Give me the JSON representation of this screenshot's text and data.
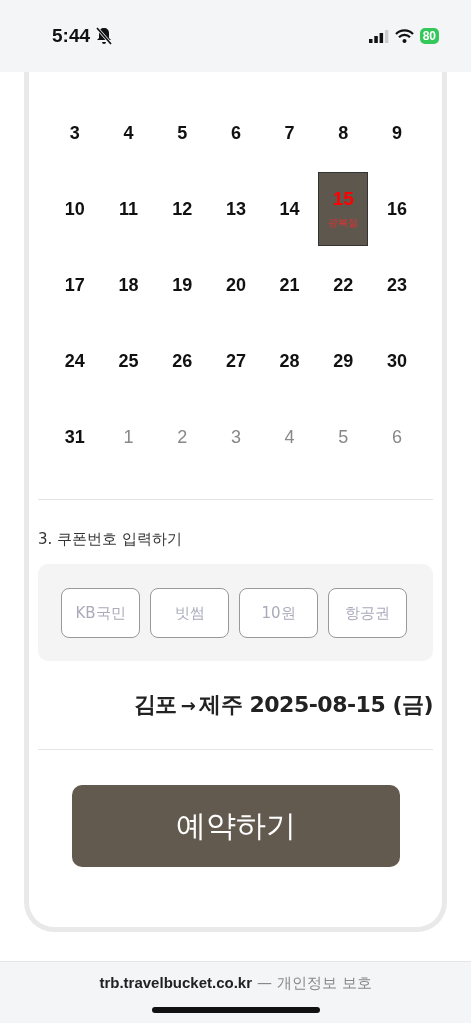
{
  "status_bar": {
    "time": "5:44",
    "battery": "80"
  },
  "calendar": {
    "days": [
      {
        "day": "3",
        "other_month": false,
        "selected": false
      },
      {
        "day": "4",
        "other_month": false,
        "selected": false
      },
      {
        "day": "5",
        "other_month": false,
        "selected": false
      },
      {
        "day": "6",
        "other_month": false,
        "selected": false
      },
      {
        "day": "7",
        "other_month": false,
        "selected": false
      },
      {
        "day": "8",
        "other_month": false,
        "selected": false
      },
      {
        "day": "9",
        "other_month": false,
        "selected": false
      },
      {
        "day": "10",
        "other_month": false,
        "selected": false
      },
      {
        "day": "11",
        "other_month": false,
        "selected": false
      },
      {
        "day": "12",
        "other_month": false,
        "selected": false
      },
      {
        "day": "13",
        "other_month": false,
        "selected": false
      },
      {
        "day": "14",
        "other_month": false,
        "selected": false
      },
      {
        "day": "15",
        "other_month": false,
        "selected": true,
        "holiday": "광복절"
      },
      {
        "day": "16",
        "other_month": false,
        "selected": false
      },
      {
        "day": "17",
        "other_month": false,
        "selected": false
      },
      {
        "day": "18",
        "other_month": false,
        "selected": false
      },
      {
        "day": "19",
        "other_month": false,
        "selected": false
      },
      {
        "day": "20",
        "other_month": false,
        "selected": false
      },
      {
        "day": "21",
        "other_month": false,
        "selected": false
      },
      {
        "day": "22",
        "other_month": false,
        "selected": false
      },
      {
        "day": "23",
        "other_month": false,
        "selected": false
      },
      {
        "day": "24",
        "other_month": false,
        "selected": false
      },
      {
        "day": "25",
        "other_month": false,
        "selected": false
      },
      {
        "day": "26",
        "other_month": false,
        "selected": false
      },
      {
        "day": "27",
        "other_month": false,
        "selected": false
      },
      {
        "day": "28",
        "other_month": false,
        "selected": false
      },
      {
        "day": "29",
        "other_month": false,
        "selected": false
      },
      {
        "day": "30",
        "other_month": false,
        "selected": false
      },
      {
        "day": "31",
        "other_month": false,
        "selected": false
      },
      {
        "day": "1",
        "other_month": true,
        "selected": false
      },
      {
        "day": "2",
        "other_month": true,
        "selected": false
      },
      {
        "day": "3",
        "other_month": true,
        "selected": false
      },
      {
        "day": "4",
        "other_month": true,
        "selected": false
      },
      {
        "day": "5",
        "other_month": true,
        "selected": false
      },
      {
        "day": "6",
        "other_month": true,
        "selected": false
      }
    ]
  },
  "coupon": {
    "title": "3. 쿠폰번호 입력하기",
    "fields": [
      {
        "placeholder": "KB국민"
      },
      {
        "placeholder": "빗썸"
      },
      {
        "placeholder": "10원"
      },
      {
        "placeholder": "항공권"
      }
    ]
  },
  "route": {
    "from": "김포",
    "arrow": "→",
    "to": "제주 2025-08-15 (금)"
  },
  "book_button": "예약하기",
  "footer": {
    "domain": "trb.travelbucket.co.kr",
    "note": "— 개인정보 보호"
  }
}
